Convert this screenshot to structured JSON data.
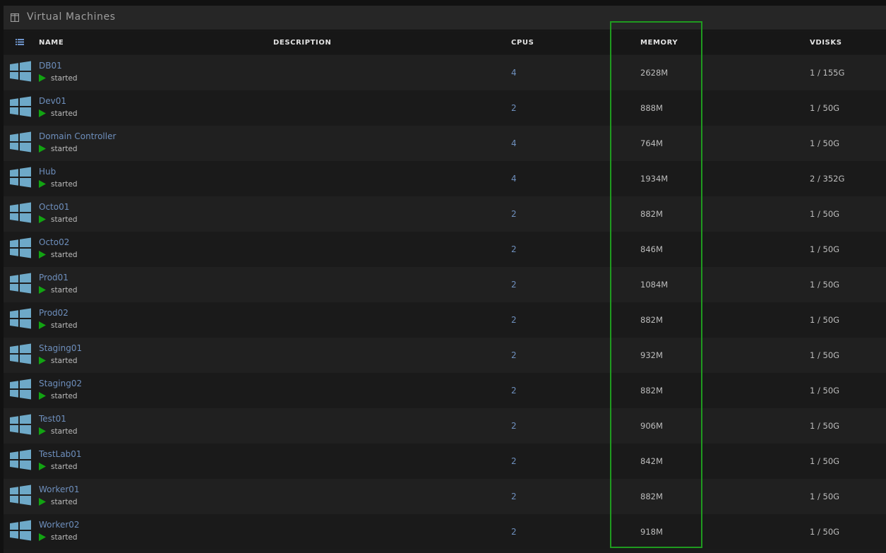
{
  "panel": {
    "title": "Virtual Machines",
    "header_icon": "columns-icon"
  },
  "columns": {
    "name": "NAME",
    "description": "DESCRIPTION",
    "cpus": "CPUS",
    "memory": "MEMORY",
    "vdisks": "VDISKS"
  },
  "colors": {
    "link": "#6e8fbd",
    "started": "#12a312",
    "highlight": "#1f9a1f",
    "windows_icon": "#6ea9c8"
  },
  "vms": [
    {
      "name": "DB01",
      "status": "started",
      "cpus": "4",
      "memory": "2628M",
      "vdisks": "1 / 155G"
    },
    {
      "name": "Dev01",
      "status": "started",
      "cpus": "2",
      "memory": "888M",
      "vdisks": "1 / 50G"
    },
    {
      "name": "Domain Controller",
      "status": "started",
      "cpus": "4",
      "memory": "764M",
      "vdisks": "1 / 50G"
    },
    {
      "name": "Hub",
      "status": "started",
      "cpus": "4",
      "memory": "1934M",
      "vdisks": "2 / 352G"
    },
    {
      "name": "Octo01",
      "status": "started",
      "cpus": "2",
      "memory": "882M",
      "vdisks": "1 / 50G"
    },
    {
      "name": "Octo02",
      "status": "started",
      "cpus": "2",
      "memory": "846M",
      "vdisks": "1 / 50G"
    },
    {
      "name": "Prod01",
      "status": "started",
      "cpus": "2",
      "memory": "1084M",
      "vdisks": "1 / 50G"
    },
    {
      "name": "Prod02",
      "status": "started",
      "cpus": "2",
      "memory": "882M",
      "vdisks": "1 / 50G"
    },
    {
      "name": "Staging01",
      "status": "started",
      "cpus": "2",
      "memory": "932M",
      "vdisks": "1 / 50G"
    },
    {
      "name": "Staging02",
      "status": "started",
      "cpus": "2",
      "memory": "882M",
      "vdisks": "1 / 50G"
    },
    {
      "name": "Test01",
      "status": "started",
      "cpus": "2",
      "memory": "906M",
      "vdisks": "1 / 50G"
    },
    {
      "name": "TestLab01",
      "status": "started",
      "cpus": "2",
      "memory": "842M",
      "vdisks": "1 / 50G"
    },
    {
      "name": "Worker01",
      "status": "started",
      "cpus": "2",
      "memory": "882M",
      "vdisks": "1 / 50G"
    },
    {
      "name": "Worker02",
      "status": "started",
      "cpus": "2",
      "memory": "918M",
      "vdisks": "1 / 50G"
    }
  ]
}
